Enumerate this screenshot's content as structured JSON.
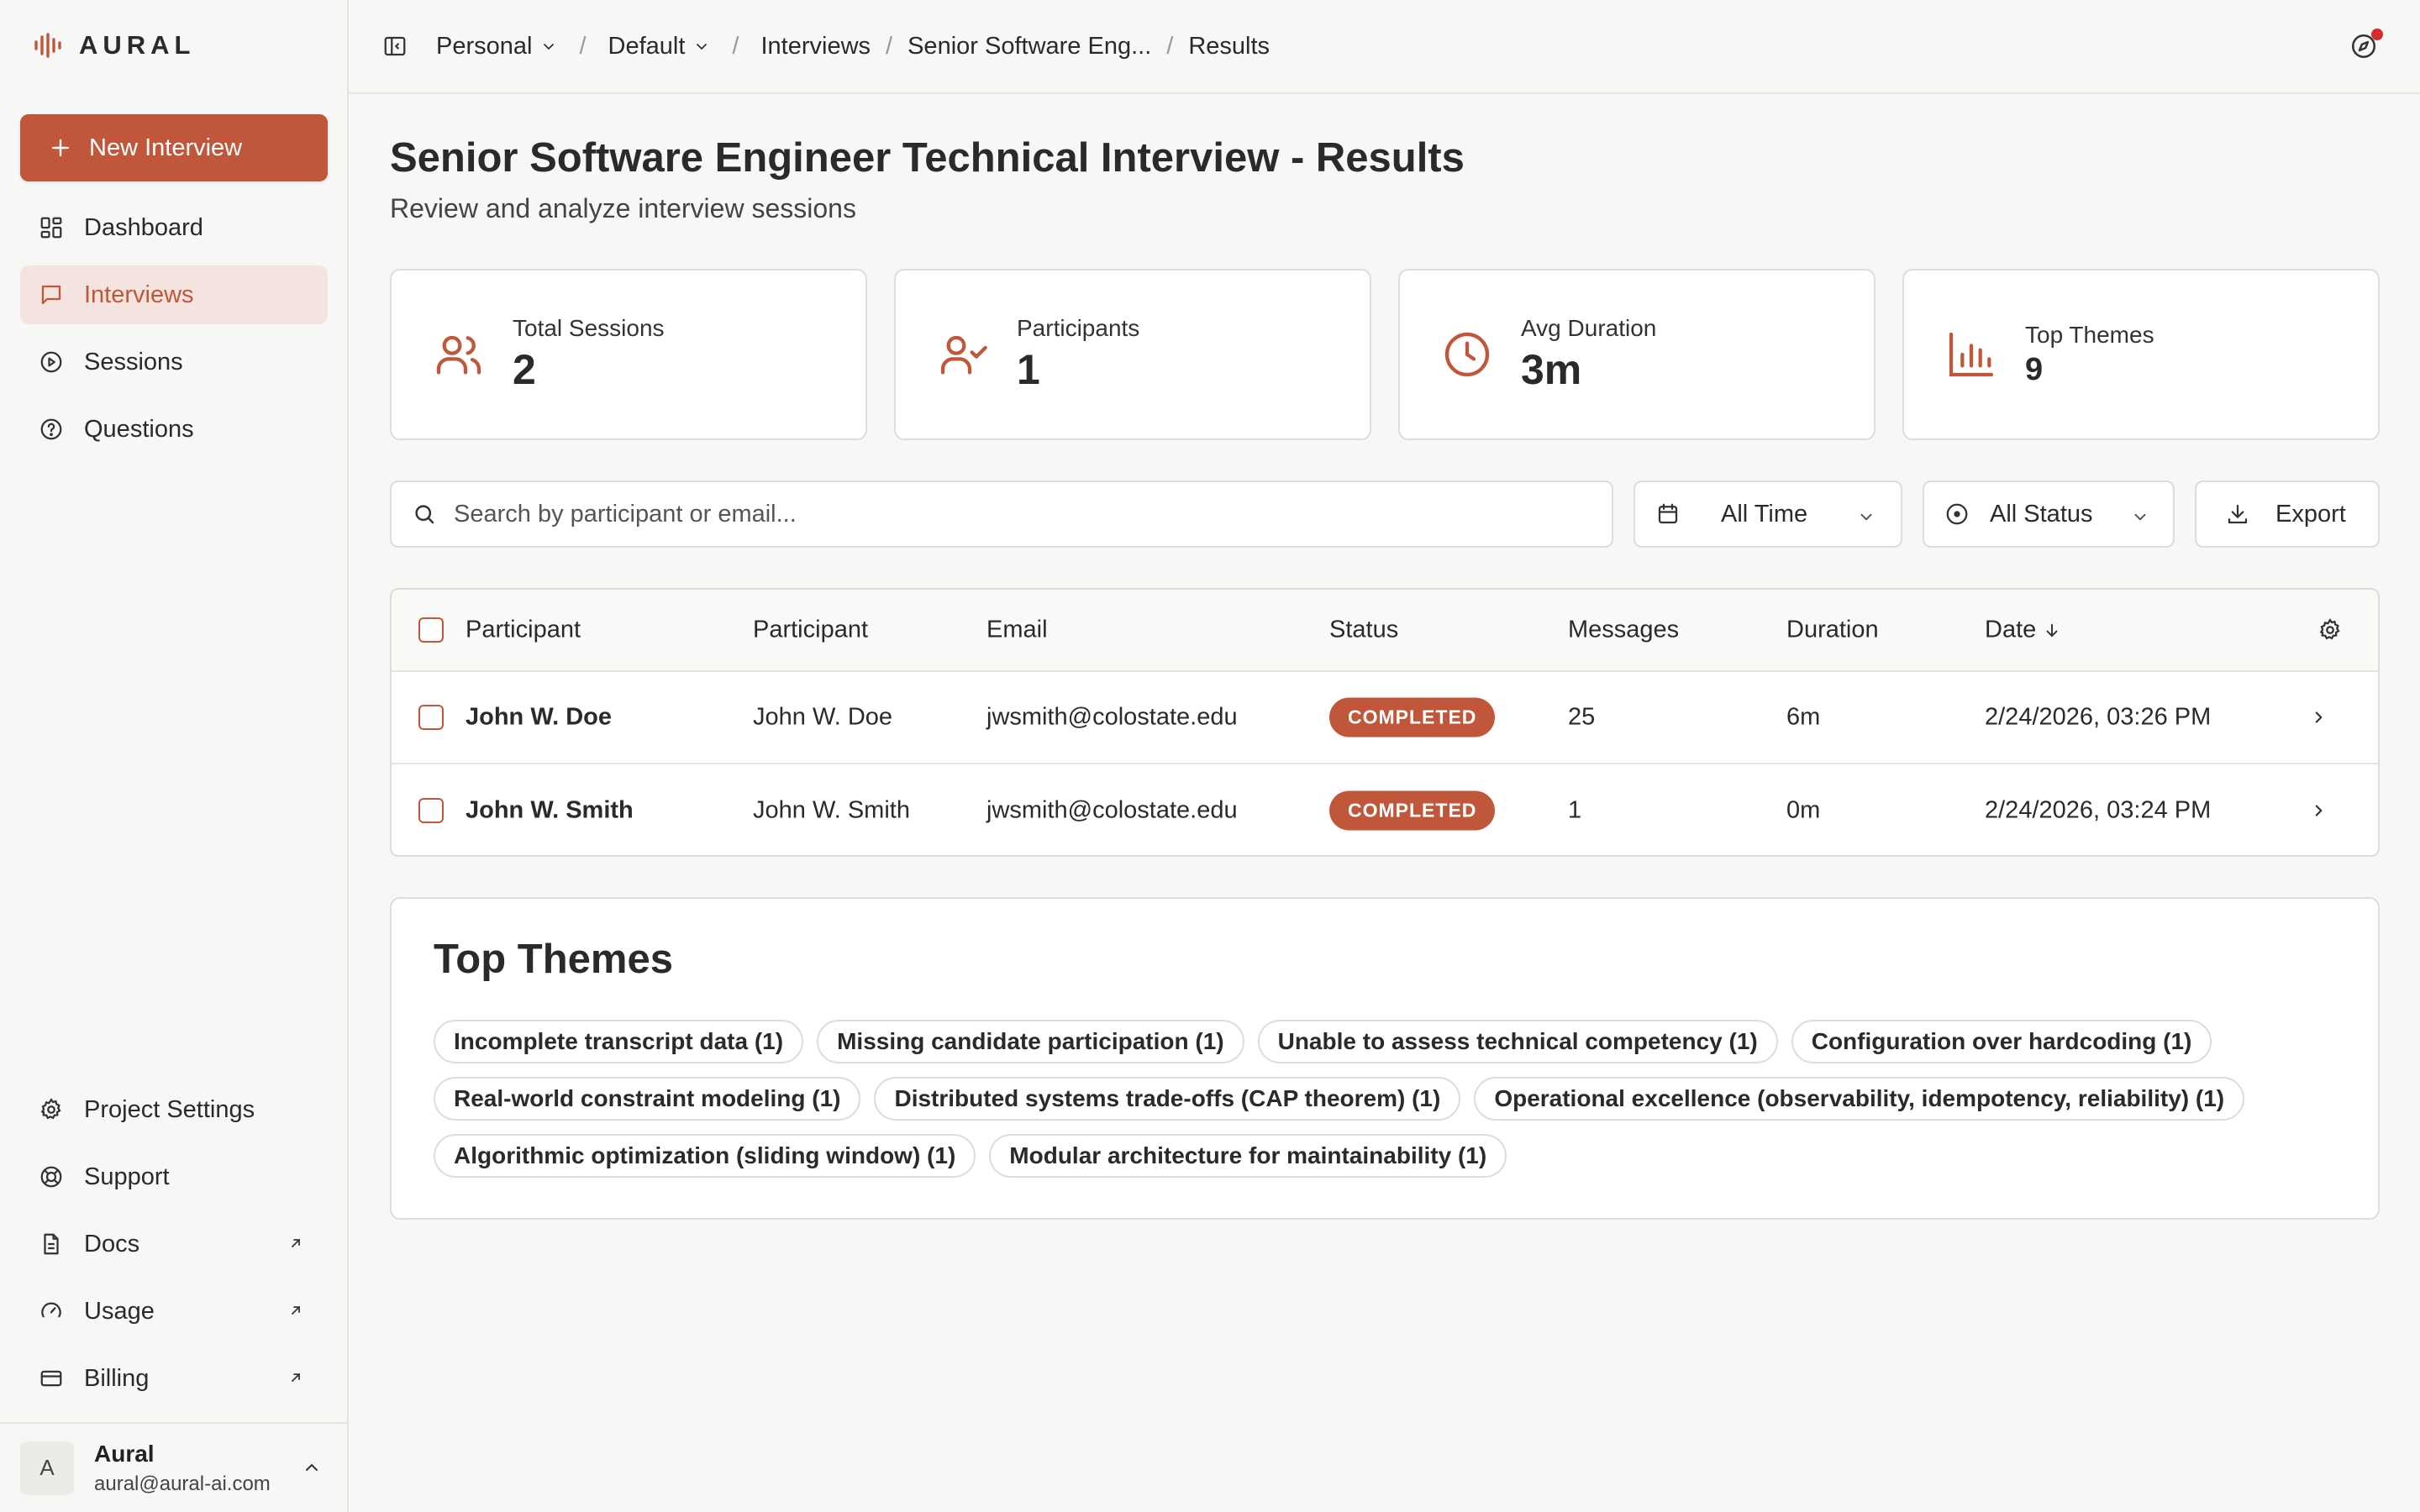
{
  "app": {
    "name": "AURAL"
  },
  "sidebar": {
    "new_button": "New Interview",
    "items": [
      {
        "label": "Dashboard",
        "icon": "dashboard-icon"
      },
      {
        "label": "Interviews",
        "icon": "message-icon",
        "active": true
      },
      {
        "label": "Sessions",
        "icon": "play-circle-icon"
      },
      {
        "label": "Questions",
        "icon": "help-circle-icon"
      }
    ],
    "bottom_items": [
      {
        "label": "Project Settings",
        "icon": "gear-icon"
      },
      {
        "label": "Support",
        "icon": "lifebuoy-icon"
      },
      {
        "label": "Docs",
        "icon": "document-icon",
        "external": true
      },
      {
        "label": "Usage",
        "icon": "gauge-icon",
        "external": true
      },
      {
        "label": "Billing",
        "icon": "credit-card-icon",
        "external": true
      }
    ],
    "user": {
      "initial": "A",
      "name": "Aural",
      "email": "aural@aural-ai.com"
    }
  },
  "breadcrumb": {
    "workspace": "Personal",
    "project": "Default",
    "section": "Interviews",
    "interview": "Senior Software Eng...",
    "page": "Results",
    "separator": "/"
  },
  "header": {
    "title": "Senior Software Engineer Technical Interview - Results",
    "subtitle": "Review and analyze interview sessions"
  },
  "stats": [
    {
      "label": "Total Sessions",
      "value": "2",
      "icon": "users-icon"
    },
    {
      "label": "Participants",
      "value": "1",
      "icon": "user-check-icon"
    },
    {
      "label": "Avg Duration",
      "value": "3m",
      "icon": "clock-icon"
    },
    {
      "label": "Top Themes",
      "value": "9",
      "icon": "bar-chart-icon"
    }
  ],
  "filters": {
    "search_placeholder": "Search by participant or email...",
    "time": "All Time",
    "status": "All Status",
    "export": "Export"
  },
  "table": {
    "columns": [
      "Participant",
      "Participant",
      "Email",
      "Status",
      "Messages",
      "Duration",
      "Date"
    ],
    "rows": [
      {
        "participant": "John W. Doe",
        "participant_name": "John W. Doe",
        "email": "jwsmith@colostate.edu",
        "status": "COMPLETED",
        "messages": "25",
        "duration": "6m",
        "date": "2/24/2026, 03:26 PM"
      },
      {
        "participant": "John W. Smith",
        "participant_name": "John W. Smith",
        "email": "jwsmith@colostate.edu",
        "status": "COMPLETED",
        "messages": "1",
        "duration": "0m",
        "date": "2/24/2026, 03:24 PM"
      }
    ]
  },
  "themes": {
    "title": "Top Themes",
    "items": [
      "Incomplete transcript data (1)",
      "Missing candidate participation (1)",
      "Unable to assess technical competency (1)",
      "Configuration over hardcoding (1)",
      "Real-world constraint modeling (1)",
      "Distributed systems trade-offs (CAP theorem) (1)",
      "Operational excellence (observability, idempotency, reliability) (1)",
      "Algorithmic optimization (sliding window) (1)",
      "Modular architecture for maintainability (1)"
    ]
  },
  "colors": {
    "accent": "#c0573b",
    "accent_soft": "#f4e4df",
    "background": "#f7f7f5",
    "notification": "#d62b2b"
  }
}
